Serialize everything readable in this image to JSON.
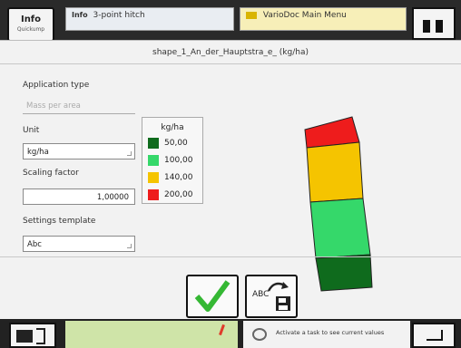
{
  "background": {
    "info_button": {
      "label": "Info",
      "sub_label": "Quickump"
    },
    "hitch_tab": {
      "badge": "Info",
      "label": "3-point hitch"
    },
    "variodoc_tab": {
      "label": "VarioDoc Main Menu"
    },
    "status_hint": "Activate a task to see current values"
  },
  "dialog": {
    "title": "shape_1_An_der_Hauptstra_e_ (kg/ha)",
    "application_type": {
      "label": "Application type",
      "value": "Mass per area"
    },
    "unit": {
      "label": "Unit",
      "value": "kg/ha"
    },
    "scaling_factor": {
      "label": "Scaling factor",
      "value": "1,00000"
    },
    "settings_template": {
      "label": "Settings template",
      "value": "Abc"
    },
    "legend": {
      "unit": "kg/ha",
      "entries": [
        {
          "value": "50,00",
          "color": "#0f6b1d"
        },
        {
          "value": "100,00",
          "color": "#35d86a"
        },
        {
          "value": "140,00",
          "color": "#f5c400"
        },
        {
          "value": "200,00",
          "color": "#ee1c1c"
        }
      ]
    },
    "buttons": {
      "confirm_icon": "checkmark-icon",
      "save_template_label": "ABC",
      "save_template_icon": "save-disk-icon"
    }
  }
}
